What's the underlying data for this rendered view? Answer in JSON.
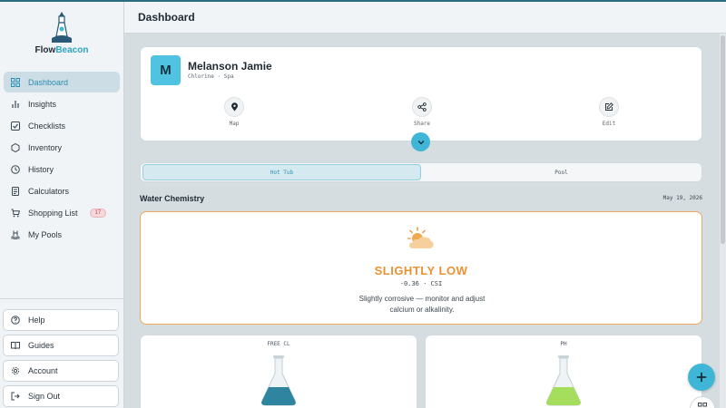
{
  "brand": {
    "name_part1": "Flow",
    "name_part2": "Beacon"
  },
  "sidebar": {
    "items": [
      {
        "label": "Dashboard",
        "icon": "grid-icon",
        "active": true
      },
      {
        "label": "Insights",
        "icon": "bar-chart-icon"
      },
      {
        "label": "Checklists",
        "icon": "checkbox-icon"
      },
      {
        "label": "Inventory",
        "icon": "hexagon-icon"
      },
      {
        "label": "History",
        "icon": "clock-icon"
      },
      {
        "label": "Calculators",
        "icon": "calculator-icon"
      },
      {
        "label": "Shopping List",
        "icon": "cart-icon",
        "badge": "17"
      },
      {
        "label": "My Pools",
        "icon": "pool-icon"
      }
    ],
    "bottom_items": [
      {
        "label": "Help",
        "icon": "help-icon"
      },
      {
        "label": "Guides",
        "icon": "book-icon"
      },
      {
        "label": "Account",
        "icon": "gear-icon"
      },
      {
        "label": "Sign Out",
        "icon": "sign-out-icon"
      }
    ]
  },
  "header": {
    "title": "Dashboard"
  },
  "profile": {
    "initial": "M",
    "name": "Melanson Jamie",
    "subtitle": "Chlorine · Spa",
    "actions": [
      {
        "label": "Map",
        "icon": "map-pin-icon"
      },
      {
        "label": "Share",
        "icon": "share-icon"
      },
      {
        "label": "Edit",
        "icon": "edit-icon"
      }
    ]
  },
  "tabs": [
    {
      "label": "Hot Tub",
      "active": true
    },
    {
      "label": "Pool",
      "active": false
    }
  ],
  "water_chemistry": {
    "title": "Water Chemistry",
    "date": "May 19, 2026",
    "status": "SLIGHTLY LOW",
    "value": "-0.36 · CSI",
    "description": "Slightly corrosive — monitor and adjust calcium or alkalinity.",
    "status_color": "#ea9233"
  },
  "metrics": [
    {
      "label": "FREE CL",
      "color": "#2f84a0"
    },
    {
      "label": "PH",
      "color": "#a5de5c"
    }
  ],
  "colors": {
    "accent": "#3fb6d6",
    "warning": "#ea9233"
  }
}
